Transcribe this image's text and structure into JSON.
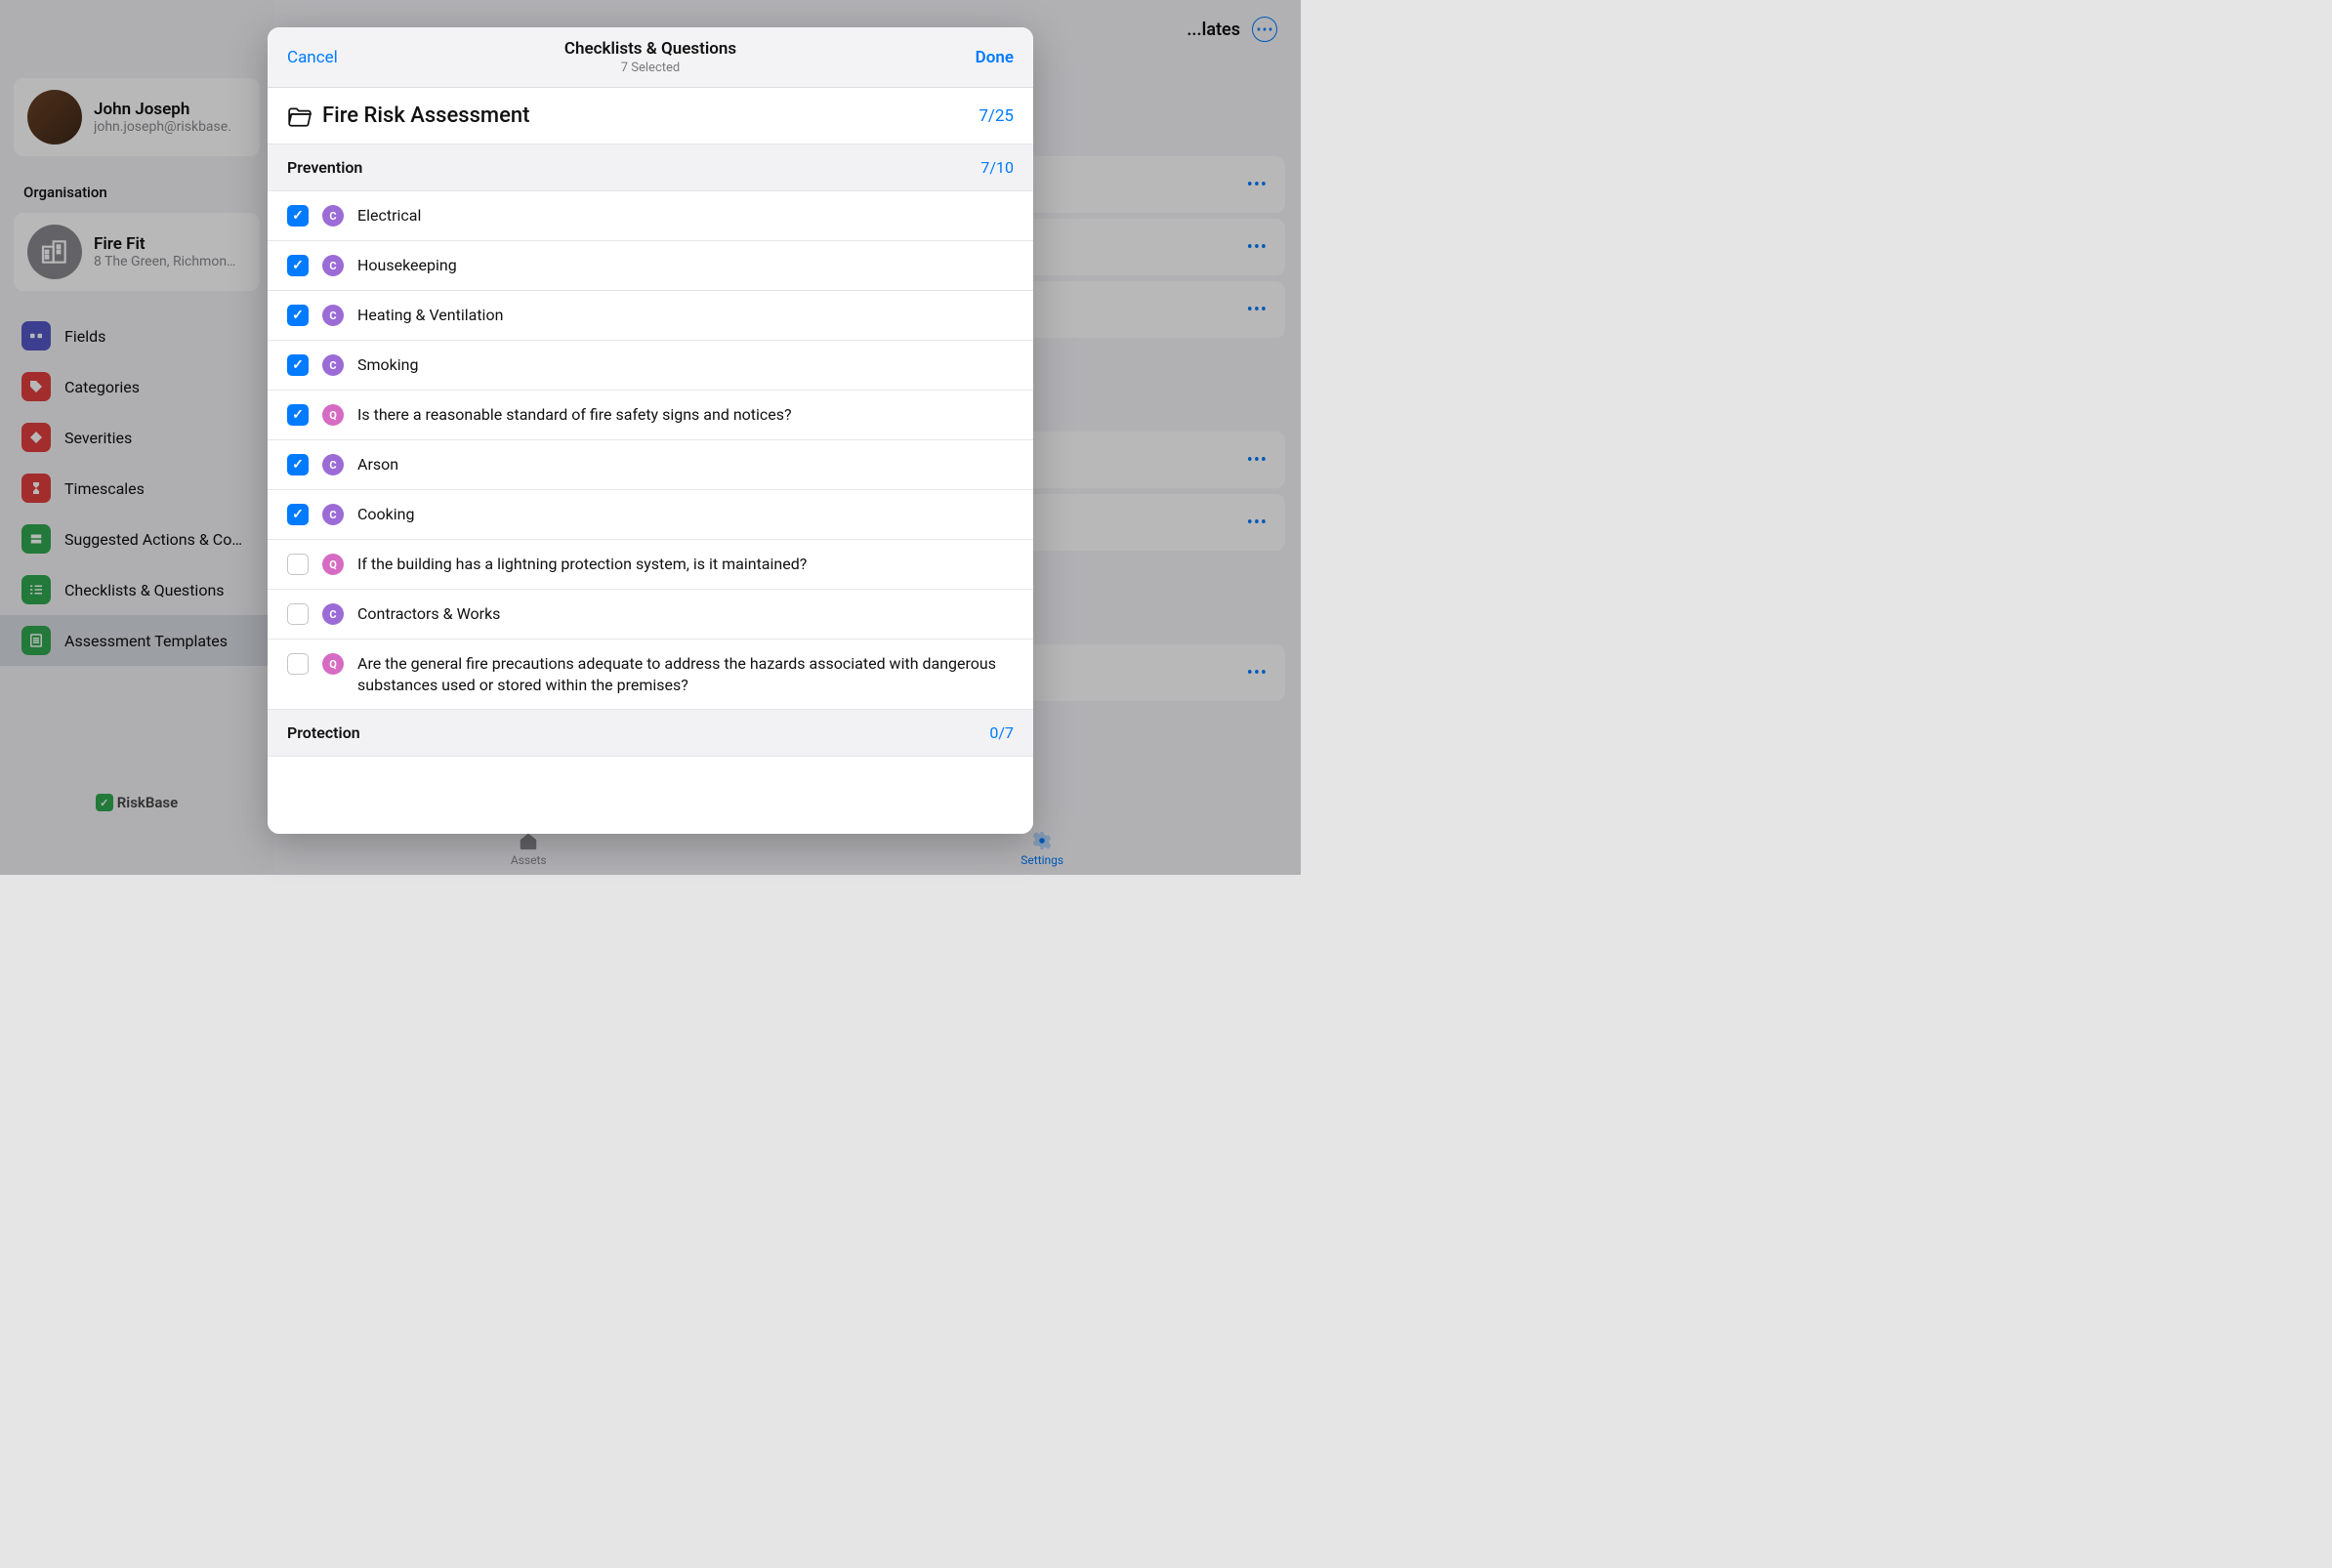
{
  "header": {
    "page_title": "...lates"
  },
  "profile": {
    "name": "John Joseph",
    "email": "john.joseph@riskbase."
  },
  "sidebar": {
    "org_label": "Organisation",
    "org_name": "Fire Fit",
    "org_addr": "8 The Green, Richmon…",
    "items": [
      {
        "label": "Fields"
      },
      {
        "label": "Categories"
      },
      {
        "label": "Severities"
      },
      {
        "label": "Timescales"
      },
      {
        "label": "Suggested Actions & Co…"
      },
      {
        "label": "Checklists & Questions"
      },
      {
        "label": "Assessment Templates"
      }
    ],
    "brand": "RiskBase"
  },
  "bottom_tabs": {
    "assets": "Assets",
    "settings": "Settings"
  },
  "modal": {
    "cancel": "Cancel",
    "done": "Done",
    "title": "Checklists & Questions",
    "subtitle": "7 Selected",
    "folder_title": "Fire Risk Assessment",
    "folder_count": "7/25",
    "groups": [
      {
        "name": "Prevention",
        "count": "7/10",
        "items": [
          {
            "checked": true,
            "type": "C",
            "label": "Electrical"
          },
          {
            "checked": true,
            "type": "C",
            "label": "Housekeeping"
          },
          {
            "checked": true,
            "type": "C",
            "label": "Heating & Ventilation"
          },
          {
            "checked": true,
            "type": "C",
            "label": "Smoking"
          },
          {
            "checked": true,
            "type": "Q",
            "label": "Is there a reasonable standard of fire safety signs and notices?"
          },
          {
            "checked": true,
            "type": "C",
            "label": "Arson"
          },
          {
            "checked": true,
            "type": "C",
            "label": "Cooking"
          },
          {
            "checked": false,
            "type": "Q",
            "label": "If the building has a lightning protection system, is it maintained?"
          },
          {
            "checked": false,
            "type": "C",
            "label": "Contractors & Works"
          },
          {
            "checked": false,
            "type": "Q",
            "label": "Are the general fire precautions adequate to address the hazards associated with dangerous substances used or stored within the premises?"
          }
        ]
      },
      {
        "name": "Protection",
        "count": "0/7",
        "items": []
      }
    ]
  }
}
